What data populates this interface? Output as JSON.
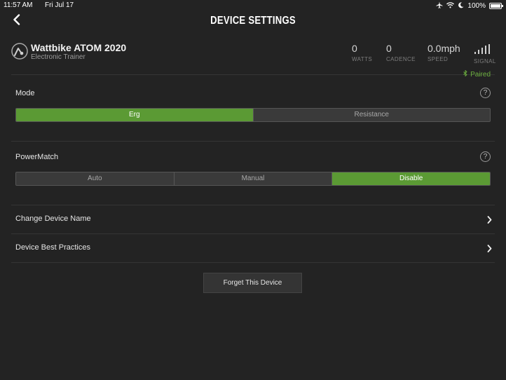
{
  "status_bar": {
    "time": "11:57 AM",
    "date": "Fri Jul 17",
    "battery": "100%",
    "icons": [
      "airplane-icon",
      "wifi-icon",
      "moon-icon",
      "battery-icon"
    ]
  },
  "nav": {
    "back_icon": "chevron-left-icon",
    "title": "DEVICE SETTINGS"
  },
  "device": {
    "icon": "trainer-icon",
    "name": "Wattbike ATOM 2020",
    "type": "Electronic Trainer",
    "metrics": [
      {
        "value": "0",
        "label": "WATTS"
      },
      {
        "value": "0",
        "label": "CADENCE"
      },
      {
        "value": "0.0mph",
        "label": "SPEED"
      }
    ],
    "signal_label": "SIGNAL",
    "paired_label": "Paired"
  },
  "mode": {
    "label": "Mode",
    "options": [
      "Erg",
      "Resistance"
    ],
    "selected": "Erg"
  },
  "powermatch": {
    "label": "PowerMatch",
    "options": [
      "Auto",
      "Manual",
      "Disable"
    ],
    "selected": "Disable"
  },
  "rows": [
    {
      "label": "Change Device Name"
    },
    {
      "label": "Device Best Practices"
    }
  ],
  "forget_button": "Forget This Device",
  "colors": {
    "background": "#232323",
    "accent_green": "#5b9a34",
    "paired_green": "#6bae3e"
  }
}
